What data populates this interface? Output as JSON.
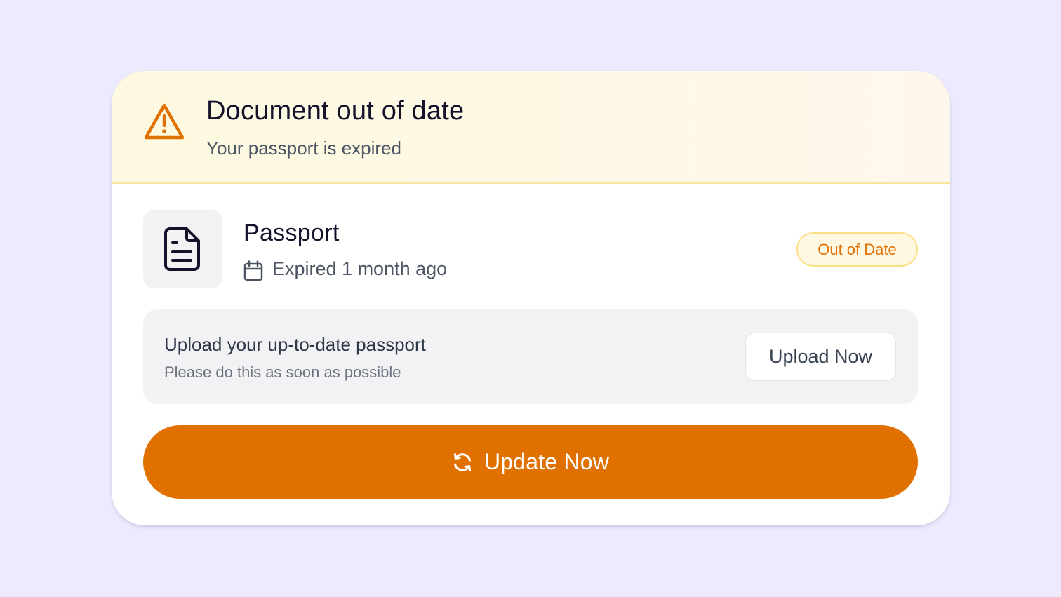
{
  "alert": {
    "icon": "warning-triangle-icon",
    "title": "Document out of date",
    "subtitle": "Your passport is expired"
  },
  "document": {
    "icon": "document-icon",
    "name": "Passport",
    "expiry_icon": "calendar-icon",
    "expiry_text": "Expired 1 month ago",
    "status_badge": "Out of Date"
  },
  "upload": {
    "title": "Upload your up-to-date passport",
    "subtitle": "Please do this as soon as possible",
    "button_label": "Upload Now"
  },
  "primary_action": {
    "icon": "refresh-icon",
    "label": "Update Now"
  },
  "colors": {
    "background": "#ecebfd",
    "accent": "#e07100",
    "warning_header": "#fef9e0",
    "badge_border": "#fbe08a",
    "badge_text": "#e07205"
  }
}
